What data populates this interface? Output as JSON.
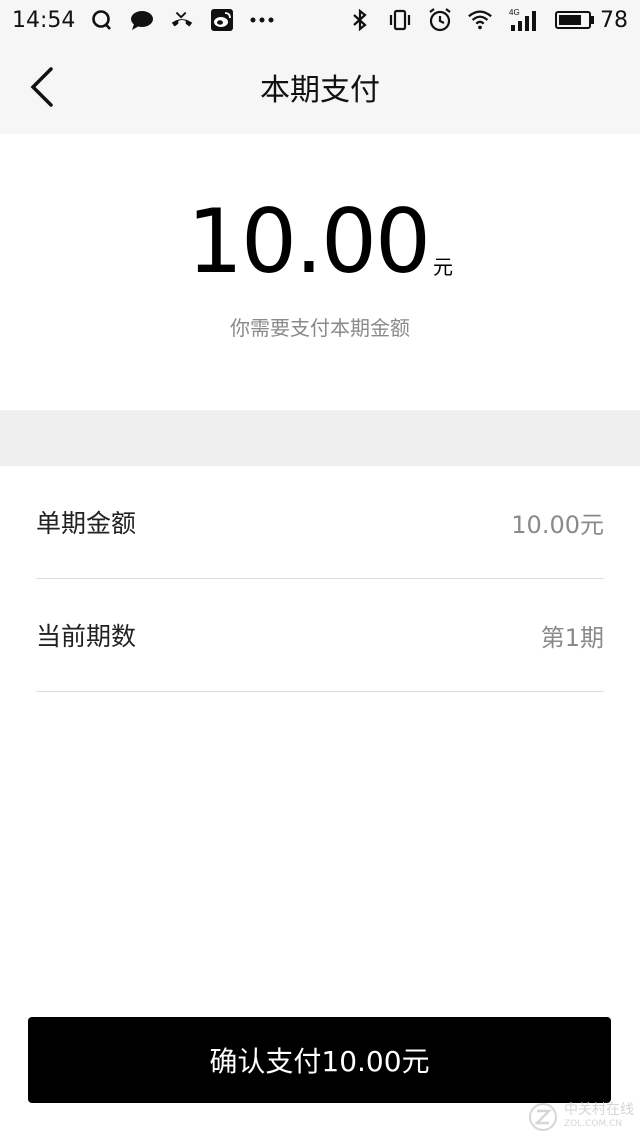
{
  "status_bar": {
    "time": "14:54",
    "battery_level": "78",
    "battery_fraction": 0.78,
    "network": "4G",
    "left_icons": [
      "qq-icon",
      "message-icon",
      "missed-call-icon",
      "weibo-icon",
      "more-dots-icon"
    ],
    "right_icons": [
      "bluetooth-icon",
      "vibrate-icon",
      "alarm-icon",
      "wifi-icon",
      "signal-icon"
    ]
  },
  "nav": {
    "title": "本期支付"
  },
  "amount": {
    "value": "10.00",
    "unit": "元",
    "description": "你需要支付本期金额"
  },
  "details": [
    {
      "label": "单期金额",
      "value": "10.00元"
    },
    {
      "label": "当前期数",
      "value": "第1期"
    }
  ],
  "confirm": {
    "label": "确认支付10.00元"
  },
  "watermark": {
    "text": "中关村在线",
    "subtext": "ZOL.COM.CN"
  },
  "colors": {
    "bar_background": "#f6f6f6",
    "band": "#efefef",
    "button": "#000000",
    "muted_text": "#8a8a8a"
  }
}
